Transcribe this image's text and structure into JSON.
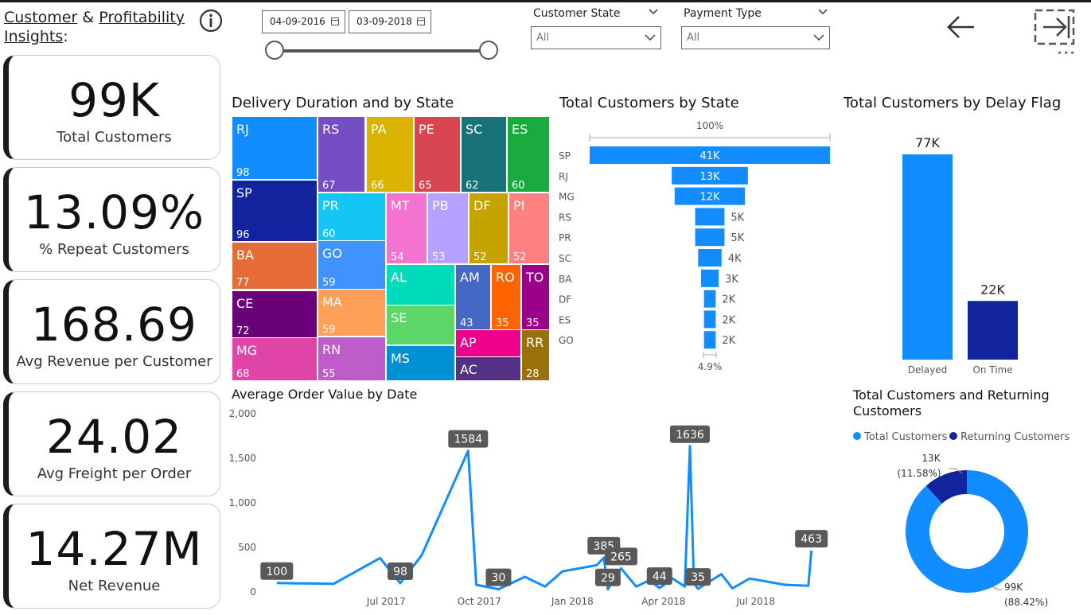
{
  "header": {
    "title_part1": "Customer",
    "title_amp": " & ",
    "title_part2": "Profitability",
    "title_part3": "Insights",
    "title_colon": ":"
  },
  "filters": {
    "date_start": "04-09-2016",
    "date_end": "03-09-2018",
    "customer_state_label": "Customer State",
    "customer_state_value": "All",
    "payment_type_label": "Payment Type",
    "payment_type_value": "All"
  },
  "kpis": [
    {
      "value": "99K",
      "label": "Total Customers"
    },
    {
      "value": "13.09%",
      "label": "% Repeat Customers"
    },
    {
      "value": "168.69",
      "label": "Avg Revenue per Customer"
    },
    {
      "value": "24.02",
      "label": "Avg Freight per Order"
    },
    {
      "value": "14.27M",
      "label": "Net Revenue"
    }
  ],
  "visual_titles": {
    "treemap": "Delivery Duration and by State",
    "funnel": "Total Customers by State",
    "delay": "Total Customers by Delay Flag",
    "line": "Average Order Value by Date",
    "donut_line1": "Total Customers and Returning",
    "donut_line2": "Customers"
  },
  "colors": {
    "primary_blue": "#118DFF",
    "dark_navy": "#12239E"
  },
  "chart_data": [
    {
      "type": "treemap",
      "title": "Delivery Duration and by State",
      "items": [
        {
          "label": "RJ",
          "value": 98,
          "color": "#118DFF"
        },
        {
          "label": "SP",
          "value": 96,
          "color": "#12239E"
        },
        {
          "label": "BA",
          "value": 77,
          "color": "#E66C37"
        },
        {
          "label": "CE",
          "value": 72,
          "color": "#6B007B"
        },
        {
          "label": "MG",
          "value": 68,
          "color": "#E044A7"
        },
        {
          "label": "RS",
          "value": 67,
          "color": "#744EC2"
        },
        {
          "label": "PA",
          "value": 66,
          "color": "#D9B300"
        },
        {
          "label": "PE",
          "value": 65,
          "color": "#D64550"
        },
        {
          "label": "SC",
          "value": 62,
          "color": "#197278"
        },
        {
          "label": "ES",
          "value": 60,
          "color": "#1AAB40"
        },
        {
          "label": "PR",
          "value": 60,
          "color": "#15C6F4"
        },
        {
          "label": "GO",
          "value": 59,
          "color": "#4092FF"
        },
        {
          "label": "MA",
          "value": 59,
          "color": "#FFA058"
        },
        {
          "label": "RN",
          "value": 55,
          "color": "#BE5DC9"
        },
        {
          "label": "MT",
          "value": 54,
          "color": "#F472D0"
        },
        {
          "label": "PB",
          "value": 53,
          "color": "#B5A1FF"
        },
        {
          "label": "DF",
          "value": 52,
          "color": "#C4A200"
        },
        {
          "label": "PI",
          "value": 52,
          "color": "#FF8080"
        },
        {
          "label": "AL",
          "value": null,
          "color": "#00DBBC"
        },
        {
          "label": "SE",
          "value": null,
          "color": "#5BD667"
        },
        {
          "label": "MS",
          "value": null,
          "color": "#0091D5"
        },
        {
          "label": "AM",
          "value": 43,
          "color": "#4668C5"
        },
        {
          "label": "RO",
          "value": 35,
          "color": "#FF6300"
        },
        {
          "label": "TO",
          "value": 35,
          "color": "#99008A"
        },
        {
          "label": "AP",
          "value": null,
          "color": "#EC008C"
        },
        {
          "label": "AC",
          "value": null,
          "color": "#533285"
        },
        {
          "label": "RR",
          "value": 28,
          "color": "#99700A"
        }
      ]
    },
    {
      "type": "bar",
      "subtype": "funnel",
      "title": "Total Customers by State",
      "top_label": "100%",
      "bottom_label": "4.9%",
      "categories": [
        "SP",
        "RJ",
        "MG",
        "RS",
        "PR",
        "SC",
        "BA",
        "DF",
        "ES",
        "GO"
      ],
      "values": [
        41,
        13,
        12,
        5,
        5,
        4,
        3,
        2,
        2,
        2
      ],
      "value_labels": [
        "41K",
        "13K",
        "12K",
        "5K",
        "5K",
        "4K",
        "3K",
        "2K",
        "2K",
        "2K"
      ]
    },
    {
      "type": "bar",
      "title": "Total Customers by Delay Flag",
      "categories": [
        "Delayed",
        "On Time"
      ],
      "values": [
        77,
        22
      ],
      "value_labels": [
        "77K",
        "22K"
      ],
      "colors": [
        "#118DFF",
        "#12239E"
      ]
    },
    {
      "type": "line",
      "title": "Average Order Value by Date",
      "ylim": [
        0,
        2000
      ],
      "y_ticks": [
        0,
        500,
        1000,
        1500,
        2000
      ],
      "y_tick_labels": [
        "0",
        "500",
        "1,000",
        "1,500",
        "2,000"
      ],
      "x_ticks": [
        "2017-07-01",
        "2017-10-01",
        "2018-01-01",
        "2018-04-01",
        "2018-07-01"
      ],
      "x_tick_labels": [
        "Jul 2017",
        "Oct 2017",
        "Jan 2018",
        "Apr 2018",
        "Jul 2018"
      ],
      "points": [
        {
          "x": "2017-03-15",
          "y": 100,
          "label": "100"
        },
        {
          "x": "2017-05-10",
          "y": 90
        },
        {
          "x": "2017-06-25",
          "y": 380
        },
        {
          "x": "2017-07-15",
          "y": 98,
          "label": "98"
        },
        {
          "x": "2017-08-05",
          "y": 410
        },
        {
          "x": "2017-09-20",
          "y": 1584,
          "label": "1584"
        },
        {
          "x": "2017-09-28",
          "y": 80
        },
        {
          "x": "2017-10-20",
          "y": 30,
          "label": "30"
        },
        {
          "x": "2017-11-15",
          "y": 170
        },
        {
          "x": "2017-12-05",
          "y": 60
        },
        {
          "x": "2017-12-22",
          "y": 230
        },
        {
          "x": "2018-01-25",
          "y": 300
        },
        {
          "x": "2018-02-01",
          "y": 385,
          "label": "385"
        },
        {
          "x": "2018-02-05",
          "y": 29,
          "label": "29"
        },
        {
          "x": "2018-02-10",
          "y": 130
        },
        {
          "x": "2018-02-18",
          "y": 265,
          "label": "265"
        },
        {
          "x": "2018-03-05",
          "y": 60
        },
        {
          "x": "2018-03-18",
          "y": 130
        },
        {
          "x": "2018-03-28",
          "y": 44,
          "label": "44"
        },
        {
          "x": "2018-04-10",
          "y": 150
        },
        {
          "x": "2018-04-22",
          "y": 60
        },
        {
          "x": "2018-04-27",
          "y": 1636,
          "label": "1636"
        },
        {
          "x": "2018-05-01",
          "y": 100
        },
        {
          "x": "2018-05-05",
          "y": 35,
          "label": "35"
        },
        {
          "x": "2018-05-28",
          "y": 200
        },
        {
          "x": "2018-06-08",
          "y": 40
        },
        {
          "x": "2018-06-25",
          "y": 150
        },
        {
          "x": "2018-07-30",
          "y": 80
        },
        {
          "x": "2018-08-22",
          "y": 70
        },
        {
          "x": "2018-08-25",
          "y": 463,
          "label": "463"
        }
      ]
    },
    {
      "type": "pie",
      "subtype": "donut",
      "title": "Total Customers and Returning Customers",
      "legend": [
        "Total Customers",
        "Returning Customers"
      ],
      "legend_position": "top",
      "slices": [
        {
          "name": "Total Customers",
          "value": 99,
          "label": "99K",
          "pct": "(88.42%)",
          "color": "#118DFF"
        },
        {
          "name": "Returning Customers",
          "value": 13,
          "label": "13K",
          "pct": "(11.58%)",
          "color": "#12239E"
        }
      ]
    }
  ]
}
